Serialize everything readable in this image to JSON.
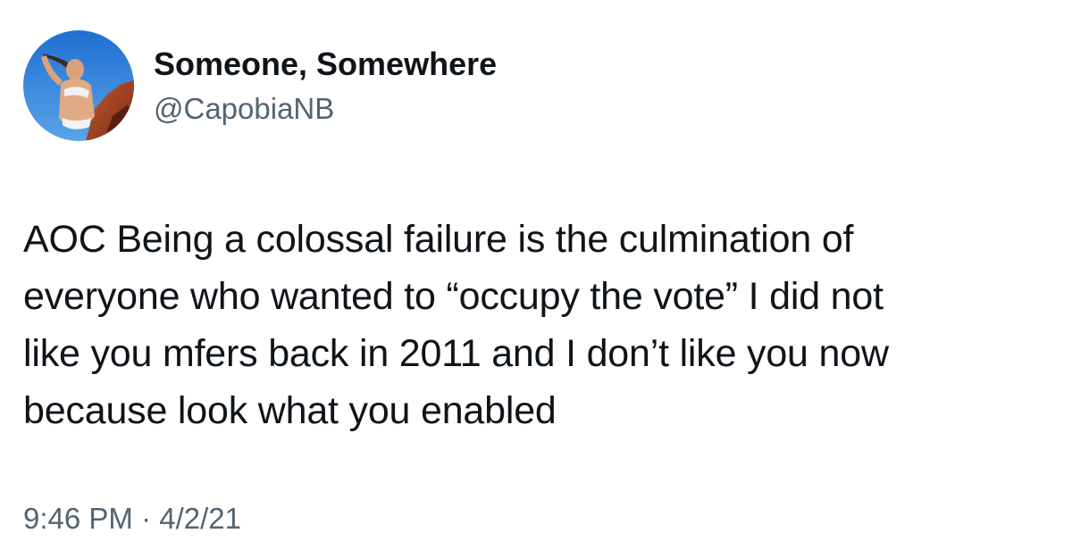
{
  "user": {
    "display_name": "Someone, Somewhere",
    "handle": "@CapobiaNB",
    "avatar_icon": "profile-photo"
  },
  "tweet": {
    "lines": [
      "AOC Being a colossal failure is the culmination of",
      "everyone who wanted to “occupy the vote” I did not",
      "like you mfers back in 2011 and I don’t like you now",
      "because look what you enabled"
    ],
    "time": "9:46 PM",
    "separator": "·",
    "date": "4/2/21"
  },
  "colors": {
    "text": "#0f1419",
    "secondary": "#536471",
    "background": "#ffffff"
  }
}
